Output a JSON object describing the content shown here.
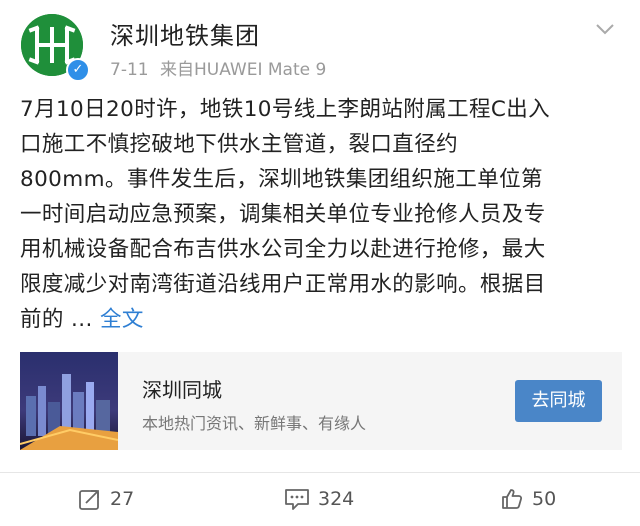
{
  "post": {
    "author": "深圳地铁集团",
    "date": "7-11",
    "source": "来自HUAWEI Mate 9",
    "body_lines": [
      "7月10日20时许，地铁10号线上李朗站附属工程C出入",
      "口施工不慎挖破地下供水主管道，裂口直径约",
      "800mm。事件发生后，深圳地铁集团组织施工单位第",
      "一时间启动应急预案，调集相关单位专业抢修人员及专",
      "用机械设备配合布吉供水公司全力以赴进行抢修，最大",
      "限度减少对南湾街道沿线用户正常用水的影响。根据目",
      "前的 ... "
    ],
    "full_text_link": "全文"
  },
  "card": {
    "title": "深圳同城",
    "subtitle": "本地热门资讯、新鲜事、有缘人",
    "button": "去同城"
  },
  "actions": {
    "repost_count": "27",
    "comment_count": "324",
    "like_count": "50"
  },
  "colors": {
    "brand_green": "#1f8f3a",
    "link_blue": "#2f7fd3",
    "button_blue": "#4a86c8",
    "verified_blue": "#2f8fe8"
  },
  "icons": [
    "verified-badge-icon",
    "chevron-down-icon",
    "repost-icon",
    "comment-icon",
    "like-icon"
  ]
}
